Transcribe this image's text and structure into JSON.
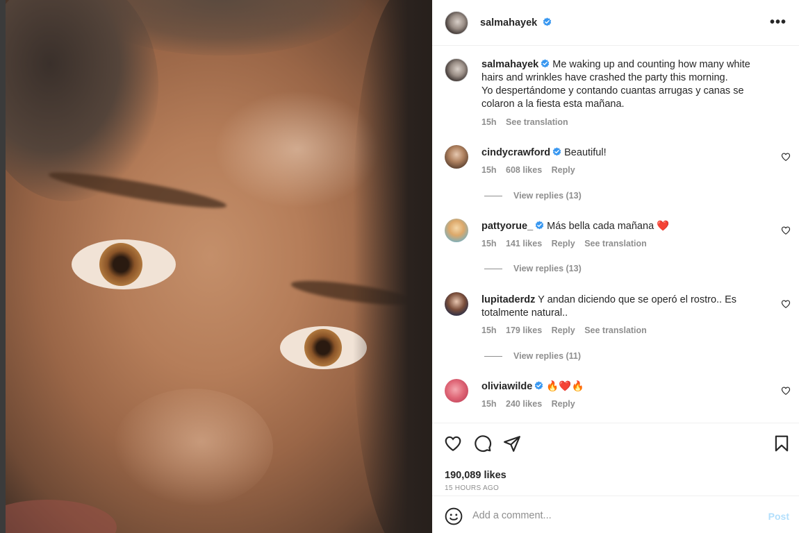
{
  "post": {
    "author": "salmahayek",
    "more_label": "•••"
  },
  "caption": {
    "username": "salmahayek",
    "text": "Me waking up and counting how many white hairs and wrinkles have crashed the party this morning.",
    "text_es": "Yo despertándome y contando cuantas arrugas y canas se colaron a la fiesta esta mañana.",
    "time": "15h",
    "see_translation": "See translation"
  },
  "comments": [
    {
      "username": "cindycrawford",
      "verified": true,
      "text": "Beautiful!",
      "time": "15h",
      "likes": "608 likes",
      "reply": "Reply",
      "see_translation": "",
      "replies": "View replies (13)"
    },
    {
      "username": "pattyorue_",
      "verified": true,
      "text": "Más bella cada mañana",
      "emoji": "❤️",
      "time": "15h",
      "likes": "141 likes",
      "reply": "Reply",
      "see_translation": "See translation",
      "replies": "View replies (13)"
    },
    {
      "username": "lupitaderdz",
      "verified": false,
      "text": "Y andan diciendo que se operó el rostro.. Es totalmente natural..",
      "time": "15h",
      "likes": "179 likes",
      "reply": "Reply",
      "see_translation": "See translation",
      "replies": "View replies (11)"
    },
    {
      "username": "oliviawilde",
      "verified": true,
      "text": "🔥❤️🔥",
      "time": "15h",
      "likes": "240 likes",
      "reply": "Reply",
      "see_translation": "",
      "replies": ""
    }
  ],
  "stats": {
    "likes": "190,089 likes",
    "ago": "15 HOURS AGO"
  },
  "composer": {
    "placeholder": "Add a comment...",
    "post_label": "Post"
  },
  "colors": {
    "verified": "#3897f0",
    "heart_red": "#ed4956",
    "muted": "#8e8e8e",
    "post_disabled": "#b2dffc"
  }
}
